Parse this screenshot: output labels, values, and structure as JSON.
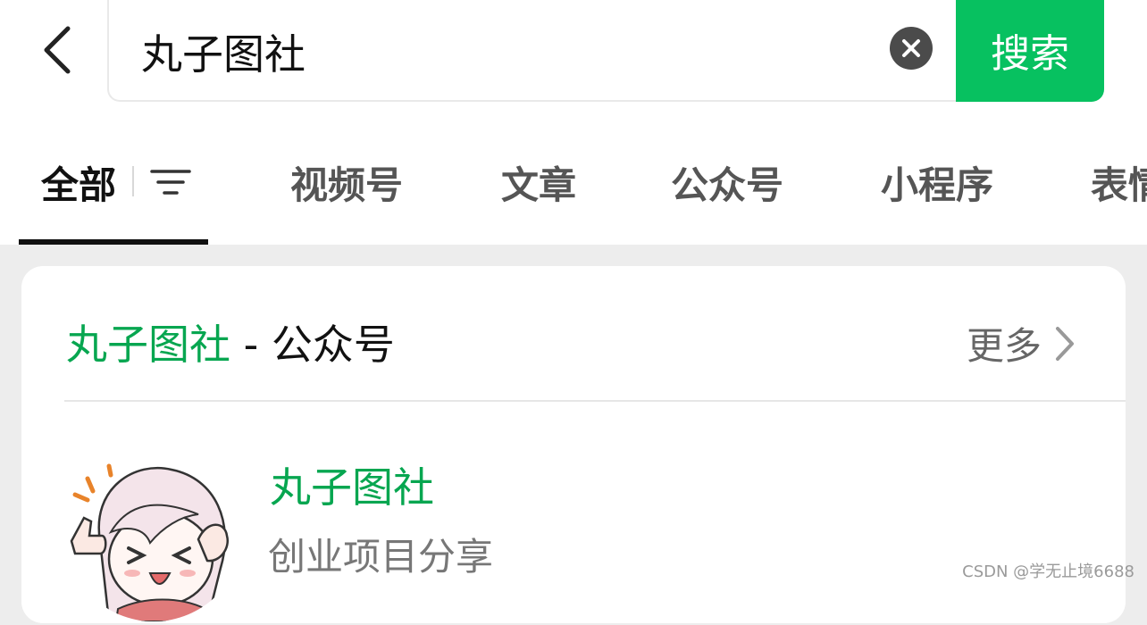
{
  "search": {
    "query": "丸子图社",
    "button_label": "搜索"
  },
  "tabs": [
    {
      "label": "全部"
    },
    {
      "label": "视频号"
    },
    {
      "label": "文章"
    },
    {
      "label": "公众号"
    },
    {
      "label": "小程序"
    },
    {
      "label": "表情"
    }
  ],
  "section": {
    "keyword": "丸子图社",
    "separator": " - ",
    "category": "公众号",
    "more_label": "更多"
  },
  "result": {
    "name": "丸子图社",
    "description": "创业项目分享"
  },
  "watermark": "CSDN @学无止境6688",
  "colors": {
    "accent_green": "#07c160",
    "keyword_green": "#07a650"
  }
}
